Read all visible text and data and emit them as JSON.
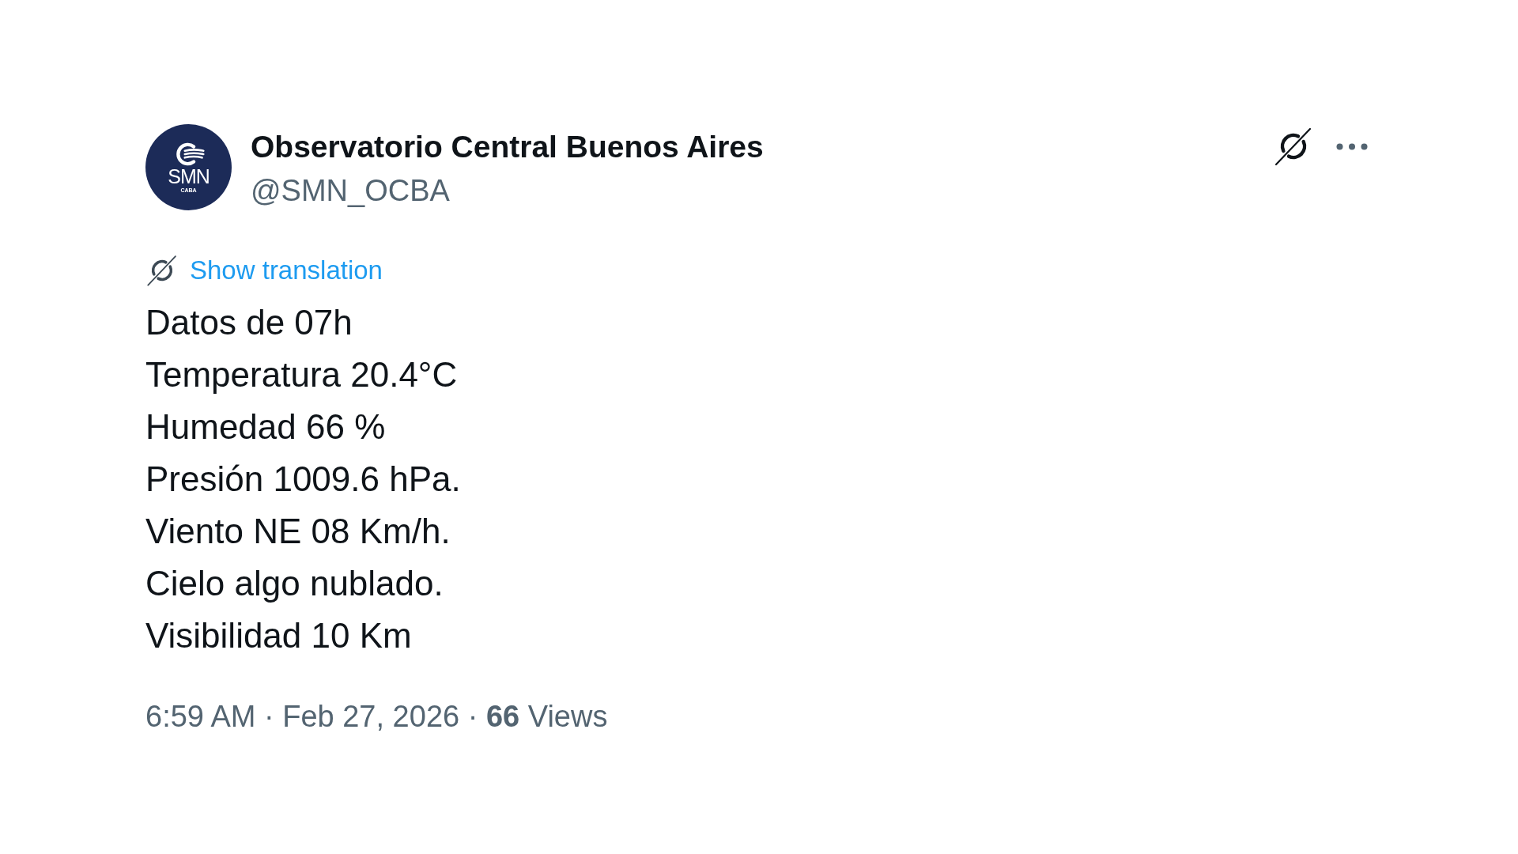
{
  "tweet": {
    "author": {
      "avatar": {
        "logo_text": "SMN",
        "logo_subtext": "CABA"
      },
      "name": "Observatorio Central Buenos Aires",
      "handle": "@SMN_OCBA"
    },
    "translation_link": "Show translation",
    "text_lines": [
      "Datos de 07h",
      "Temperatura 20.4°C",
      "Humedad 66 %",
      "Presión 1009.6 hPa.",
      "Viento NE 08 Km/h.",
      "Cielo algo nublado.",
      "Visibilidad 10 Km"
    ],
    "meta": "6:59 AM · Feb 27, 2026 · **66** Views"
  }
}
